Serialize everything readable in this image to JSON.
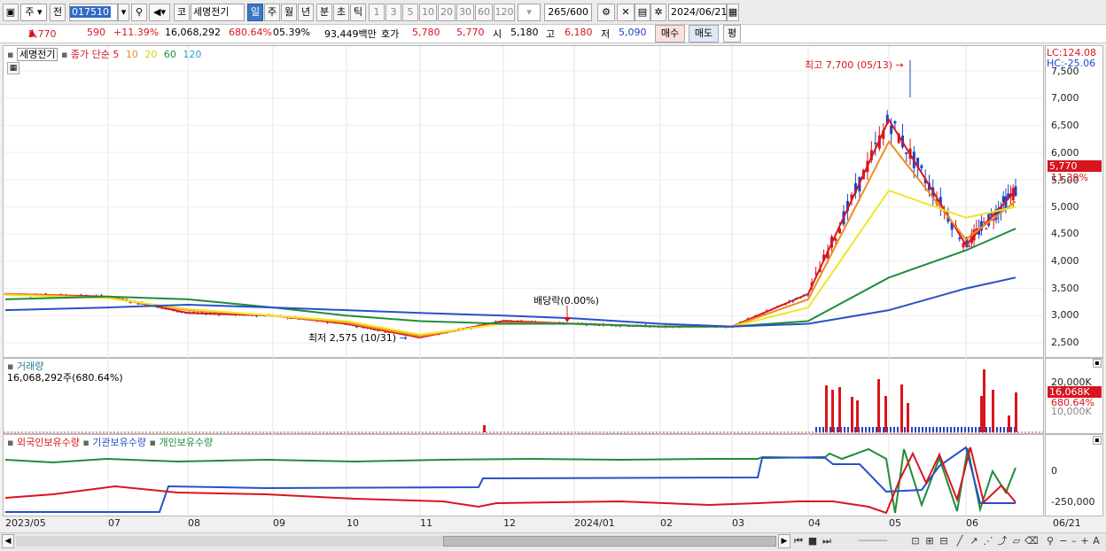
{
  "toolbar": {
    "market_short": "주",
    "prev_label": "전",
    "code": "017510",
    "market_tag": "코",
    "stock_name": "세명전기",
    "period_buttons": [
      "일",
      "주",
      "월",
      "년",
      "분",
      "초",
      "틱"
    ],
    "minute_buttons": [
      "1",
      "3",
      "5",
      "10",
      "20",
      "30",
      "60",
      "120"
    ],
    "count_value": "265",
    "count_total": "/600",
    "date_value": "2024/06/21"
  },
  "quote": {
    "price": "5,770",
    "change": "590",
    "change_pct": "+11.39%",
    "volume": "16,068,292",
    "volume_pct": "680.64%",
    "turnover_pct": "05.39%",
    "amount": "93,449백만",
    "ask_label": "호가",
    "ask_price": "5,780",
    "bid_price": "5,770",
    "open_label": "시",
    "open": "5,180",
    "high_label": "고",
    "high": "6,180",
    "low_label": "저",
    "low": "5,090",
    "buy_label": "매수",
    "sell_label": "매도",
    "eval_label": "평"
  },
  "price_pane": {
    "legend_name": "세명전기",
    "legend_ma": "종가 단순",
    "ma_periods": [
      "5",
      "10",
      "20",
      "60",
      "120"
    ],
    "ma_colors": [
      "#d8151e",
      "#f08c1e",
      "#f0e628",
      "#1e8c3c",
      "#2850c8"
    ],
    "lc_label": "LC:124.08",
    "hc_label": "HC:-25.06",
    "y_ticks": [
      "7,500",
      "7,000",
      "6,500",
      "6,000",
      "5,500",
      "5,000",
      "4,500",
      "4,000",
      "3,500",
      "3,000",
      "2,500"
    ],
    "last_price_tag": "5,770",
    "last_pct_tag": "11.39%",
    "high_annotation": "최고 7,700 (05/13)",
    "low_annotation": "최저 2,575 (10/31)",
    "dividend_annotation": "배당락(0.00%)"
  },
  "volume_pane": {
    "title": "거래량",
    "subtitle": "16,068,292주(680.64%)",
    "y_ticks": [
      "20,000K",
      "16,068K",
      "680.64%",
      "10,000K"
    ]
  },
  "holding_pane": {
    "legend": [
      "외국인보유수량",
      "기관보유수량",
      "개인보유수량"
    ],
    "legend_colors": [
      "#d8151e",
      "#2850c8",
      "#1e8c3c"
    ],
    "y_ticks": [
      "0",
      "-250,000"
    ]
  },
  "x_axis": {
    "labels": [
      "2023/05",
      "07",
      "08",
      "09",
      "10",
      "11",
      "12",
      "2024/01",
      "02",
      "03",
      "04",
      "05",
      "06",
      "06/21"
    ]
  },
  "colors": {
    "up": "#d8151e",
    "down": "#1c45c8",
    "selected": "#3c78c8"
  },
  "chart_data": {
    "type": "line",
    "title": "",
    "x": [
      "2023/05",
      "07",
      "08",
      "09",
      "10",
      "11",
      "12",
      "2024/01",
      "02",
      "03",
      "04",
      "05",
      "06",
      "06/21"
    ],
    "series": [
      {
        "name": "5",
        "values": [
          3400,
          3350,
          3050,
          3000,
          2850,
          2600,
          2900,
          2850,
          2800,
          2800,
          3400,
          6600,
          4300,
          5300
        ]
      },
      {
        "name": "10",
        "values": [
          3400,
          3330,
          3100,
          3000,
          2870,
          2620,
          2870,
          2850,
          2800,
          2800,
          3300,
          6200,
          4400,
          5100
        ]
      },
      {
        "name": "20",
        "values": [
          3380,
          3320,
          3120,
          3000,
          2900,
          2650,
          2850,
          2850,
          2800,
          2800,
          3150,
          5300,
          4800,
          5000
        ]
      },
      {
        "name": "60",
        "values": [
          3300,
          3350,
          3300,
          3150,
          3000,
          2900,
          2850,
          2850,
          2800,
          2800,
          2900,
          3700,
          4200,
          4600
        ]
      },
      {
        "name": "120",
        "values": [
          3100,
          3150,
          3200,
          3150,
          3100,
          3050,
          3000,
          2950,
          2850,
          2800,
          2850,
          3100,
          3500,
          3700
        ]
      }
    ],
    "ylim": [
      2300,
      7800
    ],
    "xlabel": "",
    "ylabel": ""
  }
}
